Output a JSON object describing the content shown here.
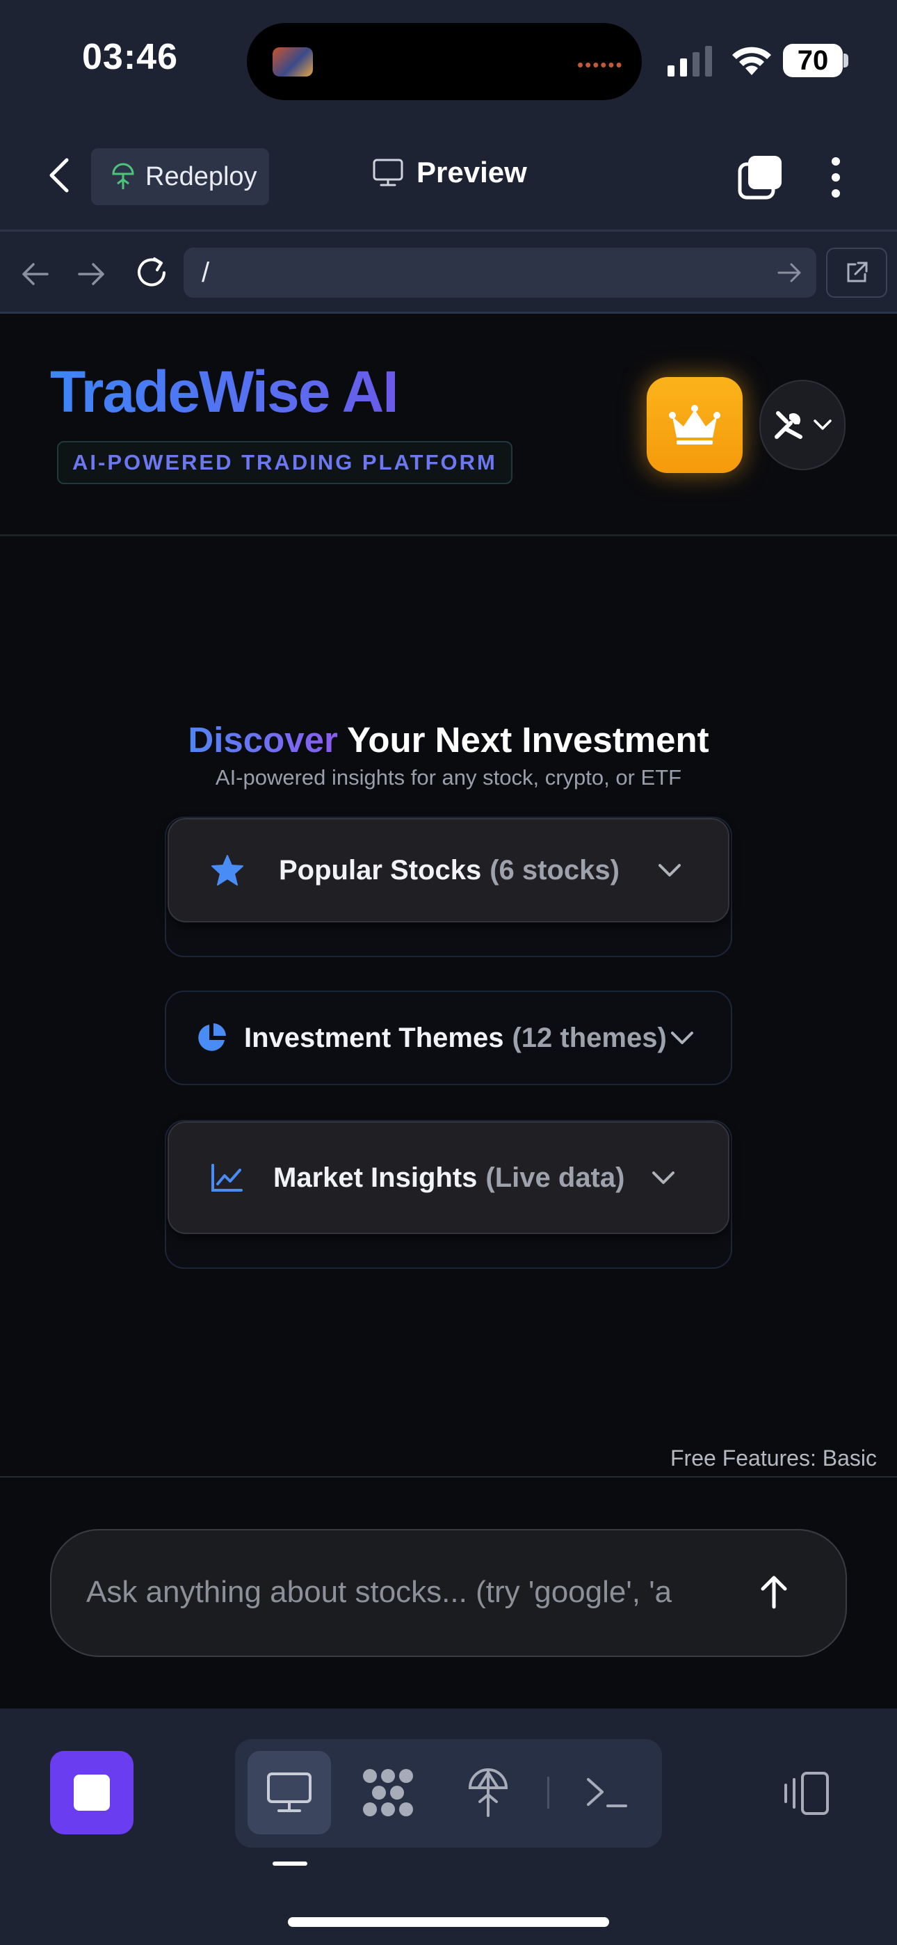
{
  "status_bar": {
    "time": "03:46",
    "battery": "70"
  },
  "browser": {
    "redeploy_label": "Redeploy",
    "preview_label": "Preview",
    "url": "/"
  },
  "app": {
    "brand": "TradeWise AI",
    "tagline": "AI-POWERED TRADING PLATFORM",
    "colors": {
      "brand": "#3d86f6",
      "crown": "#f8a611",
      "accent_purple": "#8b5cf0"
    }
  },
  "hero": {
    "title_accent": "Discover",
    "title_rest": " Your Next Investment",
    "subtitle": "AI-powered insights for any stock, crypto, or ETF"
  },
  "sections": [
    {
      "icon": "star-icon",
      "label": "Popular Stocks",
      "meta": "(6 stocks)"
    },
    {
      "icon": "pie-chart-icon",
      "label": "Investment Themes",
      "meta": "(12 themes)"
    },
    {
      "icon": "line-chart-icon",
      "label": "Market Insights",
      "meta": "(Live data)"
    }
  ],
  "footer_note": "Free Features: Basic",
  "chat": {
    "placeholder": "Ask anything about stocks... (try 'google', 'a"
  }
}
